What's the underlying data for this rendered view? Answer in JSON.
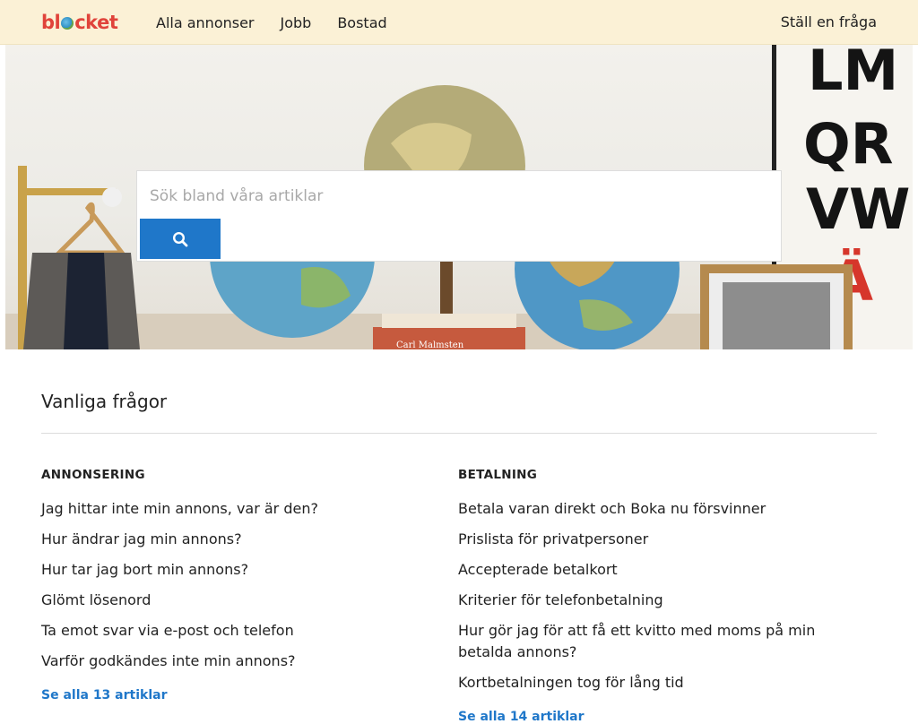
{
  "header": {
    "logo_text_left": "bl",
    "logo_text_right": "cket",
    "nav": [
      "Alla annonser",
      "Jobb",
      "Bostad"
    ],
    "ask_link": "Ställ en fråga"
  },
  "hero": {
    "search_placeholder": "Sök bland våra artiklar",
    "search_icon": "search-icon",
    "poster_letters": [
      "LM",
      "QR",
      "VW",
      "Ä"
    ],
    "book_label": "Carl Malmsten"
  },
  "faq": {
    "title": "Vanliga frågor",
    "columns": [
      {
        "heading": "ANNONSERING",
        "items": [
          "Jag hittar inte min annons, var är den?",
          "Hur ändrar jag min annons?",
          "Hur tar jag bort min annons?",
          "Glömt lösenord",
          "Ta emot svar via e-post och telefon",
          "Varför godkändes inte min annons?"
        ],
        "see_all": "Se alla 13 artiklar"
      },
      {
        "heading": "BETALNING",
        "items": [
          "Betala varan direkt och Boka nu försvinner",
          "Prislista för privatpersoner",
          "Accepterade betalkort",
          "Kriterier för telefonbetalning",
          "Hur gör jag för att få ett kvitto med moms på min betalda annons?",
          "Kortbetalningen tog för lång tid"
        ],
        "see_all": "Se alla 14 artiklar"
      }
    ]
  },
  "colors": {
    "header_bg": "#fbf1d6",
    "accent": "#1f77c9",
    "logo": "#e0433a"
  }
}
